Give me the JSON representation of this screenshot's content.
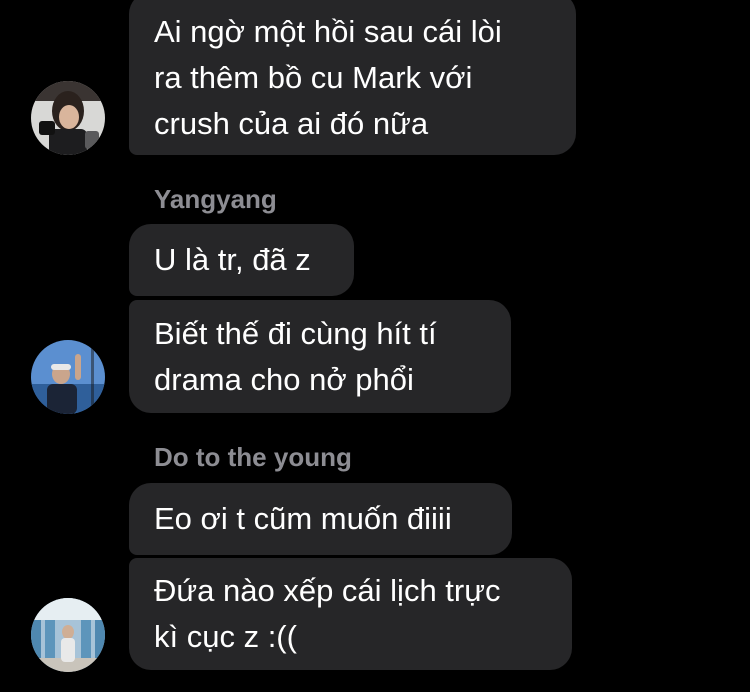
{
  "messages": [
    {
      "lines": [
        "Ai ngờ một hồi sau cái lòi",
        "ra thêm bồ cu Mark với",
        "crush của ai đó nữa"
      ]
    },
    {
      "sender": "Yangyang",
      "bubbles": [
        {
          "lines": [
            "U là tr, đã z"
          ]
        },
        {
          "lines": [
            "Biết thế đi cùng hít tí",
            "drama cho nở phổi"
          ]
        }
      ]
    },
    {
      "sender": "Do to the young",
      "bubbles": [
        {
          "lines": [
            "Eo ơi t cũm muốn điiii"
          ]
        },
        {
          "lines": [
            "Đứa nào xếp cái lịch trực",
            "kì cục z :(("
          ]
        }
      ]
    }
  ],
  "colors": {
    "background": "#000000",
    "bubble": "#262628",
    "message_text": "#ffffff",
    "sender_name": "#8d8d93"
  },
  "icons": {
    "avatar_1": "avatar-photo-icon",
    "avatar_2": "avatar-photo-icon",
    "avatar_3": "avatar-photo-icon"
  }
}
